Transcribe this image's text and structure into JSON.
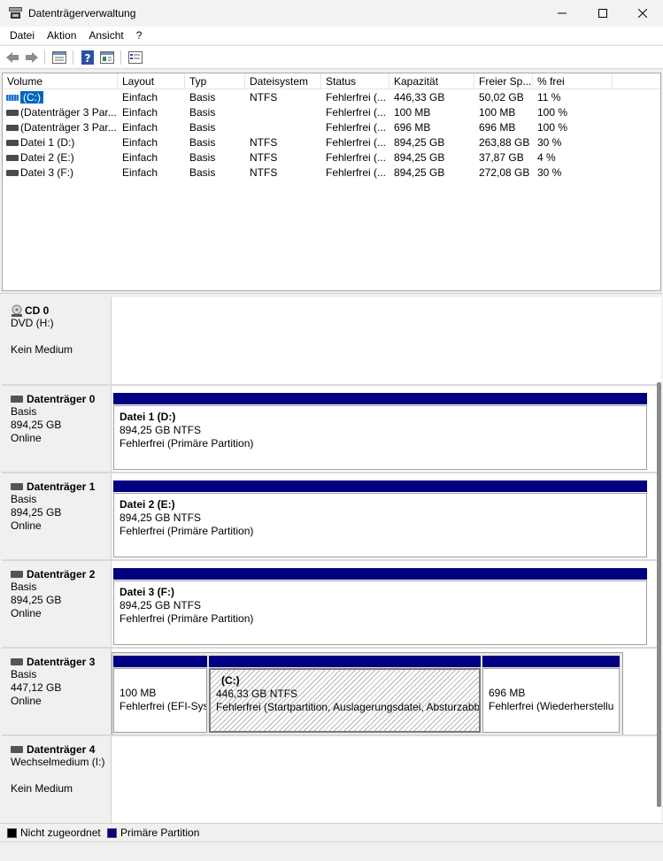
{
  "window": {
    "title": "Datenträgerverwaltung",
    "controls": {
      "minimize": "—",
      "maximize": "☐",
      "close": "✕"
    }
  },
  "menu": [
    "Datei",
    "Aktion",
    "Ansicht",
    "?"
  ],
  "toolbar": [
    "back-icon",
    "forward-icon",
    "list-view-icon",
    "help-icon",
    "properties-icon",
    "disk-list-icon"
  ],
  "volume_table": {
    "columns": [
      "Volume",
      "Layout",
      "Typ",
      "Dateisystem",
      "Status",
      "Kapazität",
      "Freier Sp...",
      "% frei"
    ],
    "rows": [
      {
        "volume": "(C:)",
        "layout": "Einfach",
        "typ": "Basis",
        "fs": "NTFS",
        "status": "Fehlerfrei (...",
        "kap": "446,33 GB",
        "frei": "50,02 GB",
        "pct": "11 %"
      },
      {
        "volume": "(Datenträger 3 Par...",
        "layout": "Einfach",
        "typ": "Basis",
        "fs": "",
        "status": "Fehlerfrei (...",
        "kap": "100 MB",
        "frei": "100 MB",
        "pct": "100 %"
      },
      {
        "volume": "(Datenträger 3 Par...",
        "layout": "Einfach",
        "typ": "Basis",
        "fs": "",
        "status": "Fehlerfrei (...",
        "kap": "696 MB",
        "frei": "696 MB",
        "pct": "100 %"
      },
      {
        "volume": "Datei 1 (D:)",
        "layout": "Einfach",
        "typ": "Basis",
        "fs": "NTFS",
        "status": "Fehlerfrei (...",
        "kap": "894,25 GB",
        "frei": "263,88 GB",
        "pct": "30 %"
      },
      {
        "volume": "Datei 2 (E:)",
        "layout": "Einfach",
        "typ": "Basis",
        "fs": "NTFS",
        "status": "Fehlerfrei (...",
        "kap": "894,25 GB",
        "frei": "37,87 GB",
        "pct": "4 %"
      },
      {
        "volume": "Datei 3 (F:)",
        "layout": "Einfach",
        "typ": "Basis",
        "fs": "NTFS",
        "status": "Fehlerfrei (...",
        "kap": "894,25 GB",
        "frei": "272,08 GB",
        "pct": "30 %"
      }
    ]
  },
  "disks": [
    {
      "name": "CD 0",
      "lines": [
        "DVD (H:)",
        "",
        "Kein Medium"
      ]
    },
    {
      "name": "Datenträger 0",
      "lines": [
        "Basis",
        "894,25 GB",
        "Online"
      ],
      "partitions": [
        {
          "name": "Datei 1  (D:)",
          "size": "894,25 GB NTFS",
          "status": "Fehlerfrei (Primäre Partition)"
        }
      ]
    },
    {
      "name": "Datenträger 1",
      "lines": [
        "Basis",
        "894,25 GB",
        "Online"
      ],
      "partitions": [
        {
          "name": "Datei 2  (E:)",
          "size": "894,25 GB NTFS",
          "status": "Fehlerfrei (Primäre Partition)"
        }
      ]
    },
    {
      "name": "Datenträger 2",
      "lines": [
        "Basis",
        "894,25 GB",
        "Online"
      ],
      "partitions": [
        {
          "name": "Datei 3  (F:)",
          "size": "894,25 GB NTFS",
          "status": "Fehlerfrei (Primäre Partition)"
        }
      ]
    },
    {
      "name": "Datenträger 3",
      "lines": [
        "Basis",
        "447,12 GB",
        "Online"
      ],
      "partitions": [
        {
          "name": "",
          "size": "100 MB",
          "status": "Fehlerfrei (EFI-Sys"
        },
        {
          "name": "(C:)",
          "size": "446,33 GB NTFS",
          "status": "Fehlerfrei (Startpartition, Auslagerungsdatei, Absturzabb"
        },
        {
          "name": "",
          "size": "696 MB",
          "status": "Fehlerfrei (Wiederherstellu"
        }
      ]
    },
    {
      "name": "Datenträger 4",
      "lines": [
        "Wechselmedium (I:)",
        "",
        "Kein Medium"
      ]
    }
  ],
  "legend": [
    {
      "label": "Nicht zugeordnet",
      "color": "#000000"
    },
    {
      "label": "Primäre Partition",
      "color": "#000080"
    }
  ]
}
